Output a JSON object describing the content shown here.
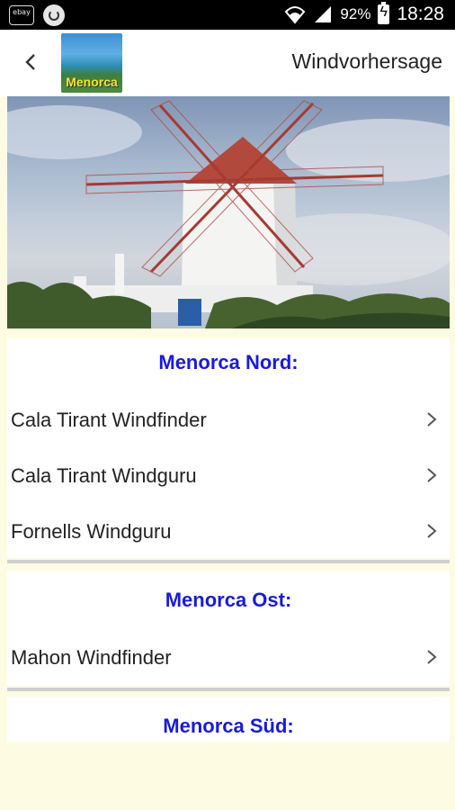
{
  "status_bar": {
    "left_icons": [
      "ebay-icon",
      "sync-icon"
    ],
    "ebay_text": "ebay",
    "battery": "92%",
    "time": "18:28"
  },
  "appbar": {
    "logo_text": "Menorca",
    "title": "Windvorhersage"
  },
  "sections": [
    {
      "header": "Menorca Nord:",
      "items": [
        {
          "label": "Cala Tirant Windfinder"
        },
        {
          "label": "Cala Tirant Windguru"
        },
        {
          "label": "Fornells Windguru"
        }
      ]
    },
    {
      "header": "Menorca Ost:",
      "items": [
        {
          "label": "Mahon Windfinder"
        }
      ]
    },
    {
      "header": "Menorca Süd:",
      "items": []
    }
  ],
  "colors": {
    "header_text": "#1a1ad8",
    "background": "#fdfce3"
  }
}
